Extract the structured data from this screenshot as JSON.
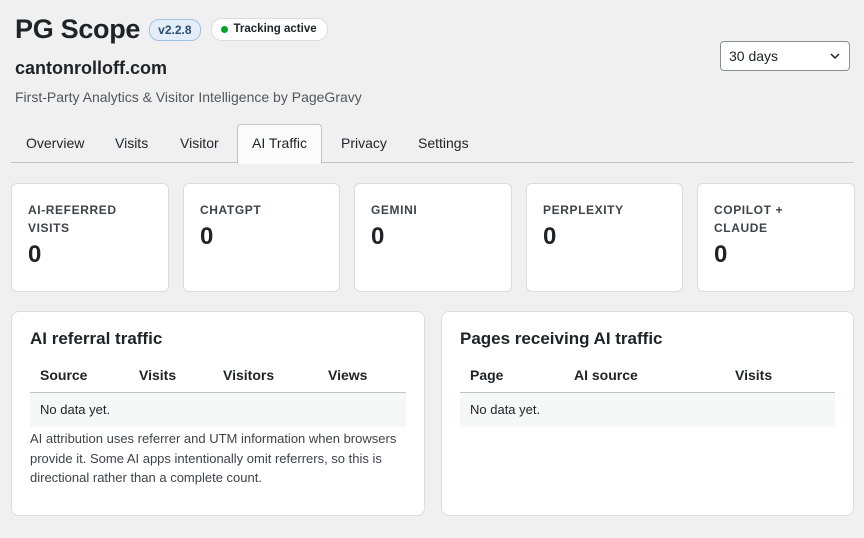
{
  "app": {
    "title": "PG Scope",
    "version": "v2.2.8",
    "status": "Tracking active",
    "site": "cantonrolloff.com",
    "subtitle": "First-Party Analytics & Visitor Intelligence by PageGravy",
    "status_color": "#00a32a"
  },
  "range": {
    "selected": "30 days",
    "icon": "chevron-down-icon"
  },
  "tabs": [
    {
      "label": "Overview"
    },
    {
      "label": "Visits"
    },
    {
      "label": "Visitor"
    },
    {
      "label": "AI Traffic",
      "active": true
    },
    {
      "label": "Privacy"
    },
    {
      "label": "Settings"
    }
  ],
  "stats": [
    {
      "label": "AI-REFERRED VISITS",
      "value": "0"
    },
    {
      "label": "CHATGPT",
      "value": "0"
    },
    {
      "label": "GEMINI",
      "value": "0"
    },
    {
      "label": "PERPLEXITY",
      "value": "0"
    },
    {
      "label": "COPILOT + CLAUDE",
      "value": "0"
    }
  ],
  "referral_panel": {
    "title": "AI referral traffic",
    "columns": [
      "Source",
      "Visits",
      "Visitors",
      "Views"
    ],
    "empty_text": "No data yet.",
    "note": "AI attribution uses referrer and UTM information when browsers provide it. Some AI apps intentionally omit referrers, so this is directional rather than a complete count."
  },
  "pages_panel": {
    "title": "Pages receiving AI traffic",
    "columns": [
      "Page",
      "AI source",
      "Visits"
    ],
    "empty_text": "No data yet."
  }
}
